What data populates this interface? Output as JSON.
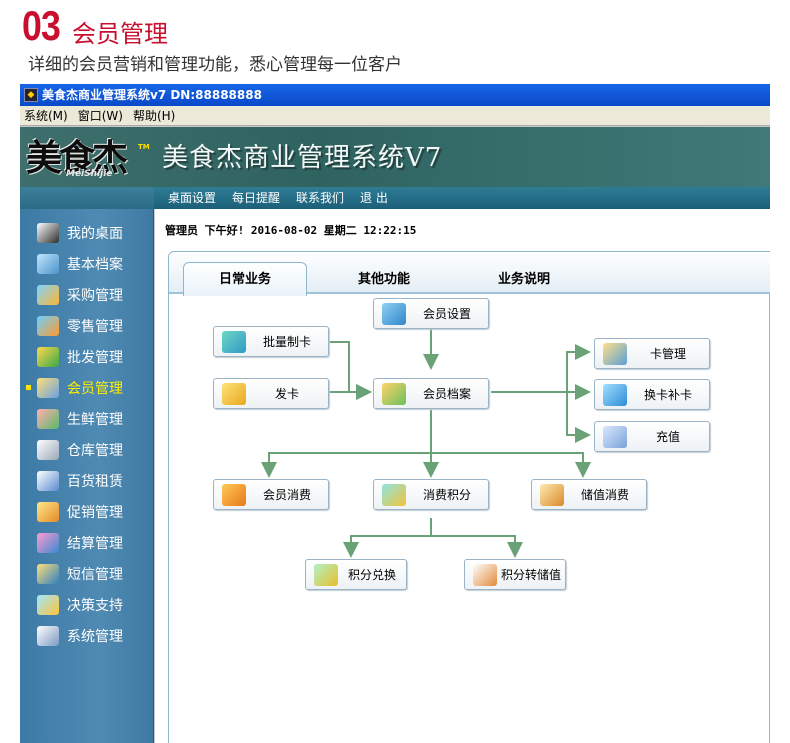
{
  "promo": {
    "number": "03",
    "title": "会员管理",
    "subtitle": "详细的会员营销和管理功能，悉心管理每一位客户"
  },
  "window": {
    "title": "美食杰商业管理系统v7 DN:88888888",
    "menu": [
      "系统(M)",
      "窗口(W)",
      "帮助(H)"
    ]
  },
  "banner": {
    "logo_cn": "美食杰",
    "logo_en": "MeiShijie",
    "logo_tm": "TM",
    "title": "美食杰商业管理系统V7"
  },
  "topnav": [
    "桌面设置",
    "每日提醒",
    "联系我们",
    "退 出"
  ],
  "sidebar": {
    "items": [
      {
        "label": "我的桌面",
        "icon": "monitor-icon",
        "active": false
      },
      {
        "label": "基本档案",
        "icon": "document-icon",
        "active": false
      },
      {
        "label": "采购管理",
        "icon": "truck-icon",
        "active": false
      },
      {
        "label": "零售管理",
        "icon": "pos-icon",
        "active": false
      },
      {
        "label": "批发管理",
        "icon": "box-icon",
        "active": false
      },
      {
        "label": "会员管理",
        "icon": "members-icon",
        "active": true
      },
      {
        "label": "生鲜管理",
        "icon": "produce-icon",
        "active": false
      },
      {
        "label": "仓库管理",
        "icon": "warehouse-icon",
        "active": false
      },
      {
        "label": "百货租赁",
        "icon": "lease-icon",
        "active": false
      },
      {
        "label": "促销管理",
        "icon": "promotion-icon",
        "active": false
      },
      {
        "label": "结算管理",
        "icon": "settlement-icon",
        "active": false
      },
      {
        "label": "短信管理",
        "icon": "sms-icon",
        "active": false
      },
      {
        "label": "决策支持",
        "icon": "globe-icon",
        "active": false
      },
      {
        "label": "系统管理",
        "icon": "system-icon",
        "active": false
      }
    ]
  },
  "status": "管理员 下午好! 2016-08-02 星期二 12:22:15",
  "tabs": [
    "日常业务",
    "其他功能",
    "业务说明"
  ],
  "flow": {
    "member_settings": "会员设置",
    "batch_card": "批量制卡",
    "issue_card": "发卡",
    "member_records": "会员档案",
    "card_management": "卡管理",
    "card_replace": "换卡补卡",
    "recharge": "充值",
    "member_consume": "会员消费",
    "points_consume": "消费积分",
    "stored_value_consume": "储值消费",
    "points_exchange": "积分兑换",
    "points_to_value": "积分转储值"
  },
  "colors": {
    "promo_red": "#c8102e",
    "sidebar_blue": "#4a86b0",
    "active_yellow": "#ffee00",
    "arrow_green": "#6aa176"
  }
}
